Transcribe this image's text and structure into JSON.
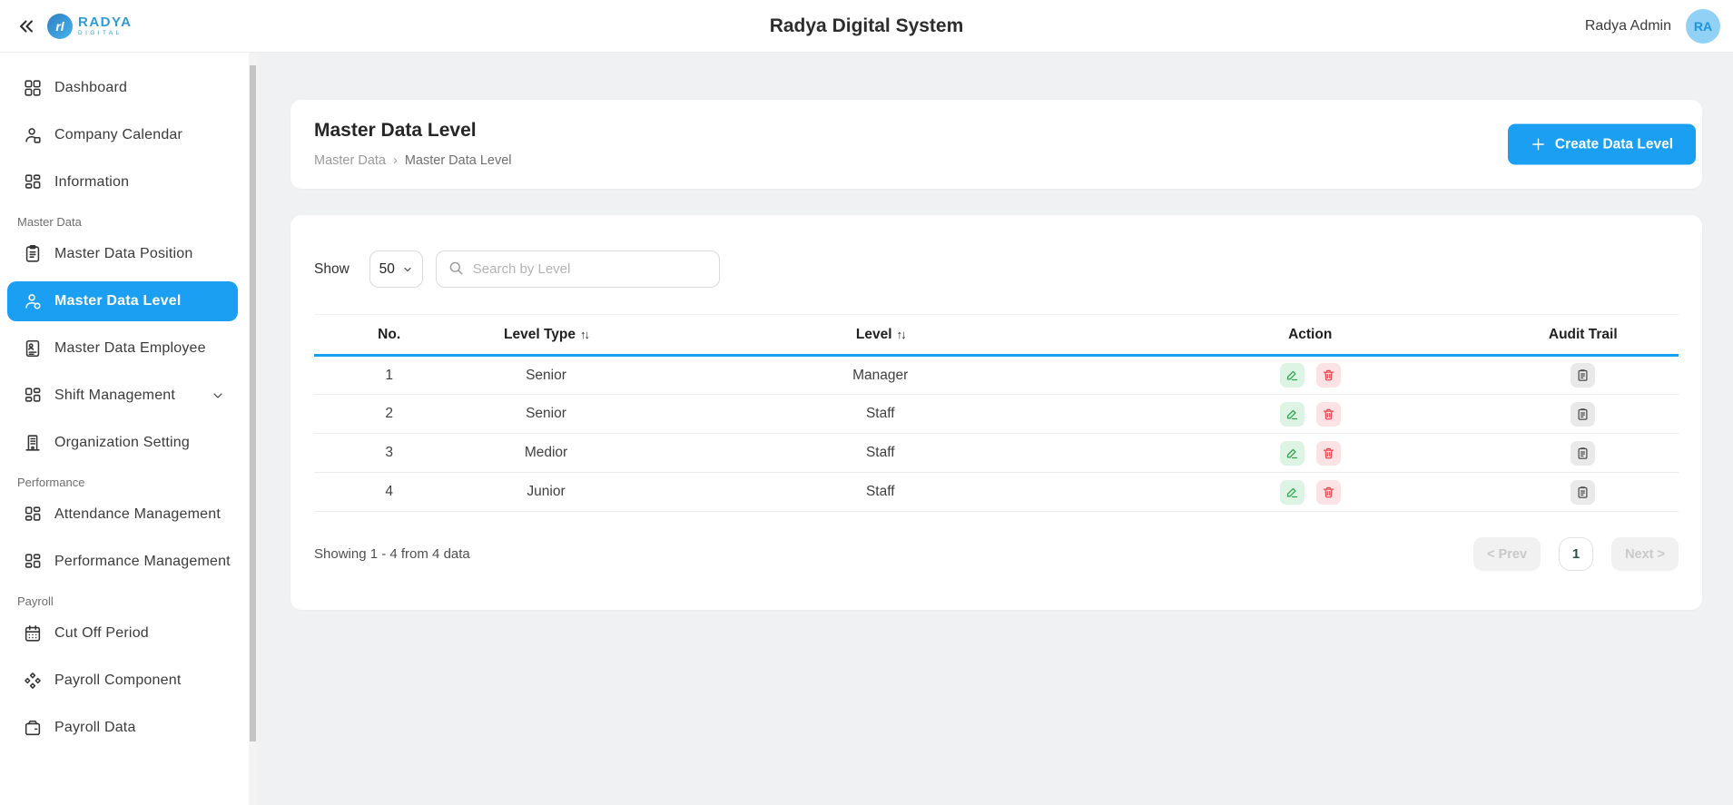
{
  "header": {
    "title": "Radya Digital System",
    "user_name": "Radya Admin",
    "avatar_initials": "RA",
    "logo": {
      "brand": "RADYA",
      "sub": "DIGITAL",
      "mark": "rl"
    }
  },
  "sidebar": {
    "sections": [
      {
        "label": "",
        "items": [
          {
            "label": "Dashboard"
          },
          {
            "label": "Company Calendar"
          },
          {
            "label": "Information"
          }
        ]
      },
      {
        "label": "Master Data",
        "items": [
          {
            "label": "Master Data Position"
          },
          {
            "label": "Master Data Level",
            "active": true
          },
          {
            "label": "Master Data Employee"
          },
          {
            "label": "Shift Management",
            "expandable": true
          },
          {
            "label": "Organization Setting"
          }
        ]
      },
      {
        "label": "Performance",
        "items": [
          {
            "label": "Attendance Management"
          },
          {
            "label": "Performance Management"
          }
        ]
      },
      {
        "label": "Payroll",
        "items": [
          {
            "label": "Cut Off Period"
          },
          {
            "label": "Payroll Component"
          },
          {
            "label": "Payroll Data"
          }
        ]
      }
    ]
  },
  "page": {
    "title": "Master Data Level",
    "breadcrumb": {
      "parent": "Master Data",
      "separator": "›",
      "current": "Master Data Level"
    },
    "create_button_label": "Create Data Level"
  },
  "controls": {
    "show_label": "Show",
    "page_size": "50",
    "search_placeholder": "Search by Level"
  },
  "table": {
    "sort_glyph": "↑↓",
    "columns": {
      "no": "No.",
      "level_type": "Level Type",
      "level": "Level",
      "action": "Action",
      "audit_trail": "Audit Trail"
    },
    "rows": [
      {
        "no": "1",
        "level_type": "Senior",
        "level": "Manager"
      },
      {
        "no": "2",
        "level_type": "Senior",
        "level": "Staff"
      },
      {
        "no": "3",
        "level_type": "Medior",
        "level": "Staff"
      },
      {
        "no": "4",
        "level_type": "Junior",
        "level": "Staff"
      }
    ]
  },
  "pagination": {
    "summary": "Showing 1 - 4 from 4 data",
    "prev_label": "< Prev",
    "current_page": "1",
    "next_label": "Next >"
  },
  "colors": {
    "accent_blue": "#1b9ff2",
    "edit_green": "#2da44e",
    "delete_red": "#e5484d",
    "audit_gray": "#4a4a4a",
    "avatar_bg": "#90d1f5"
  }
}
